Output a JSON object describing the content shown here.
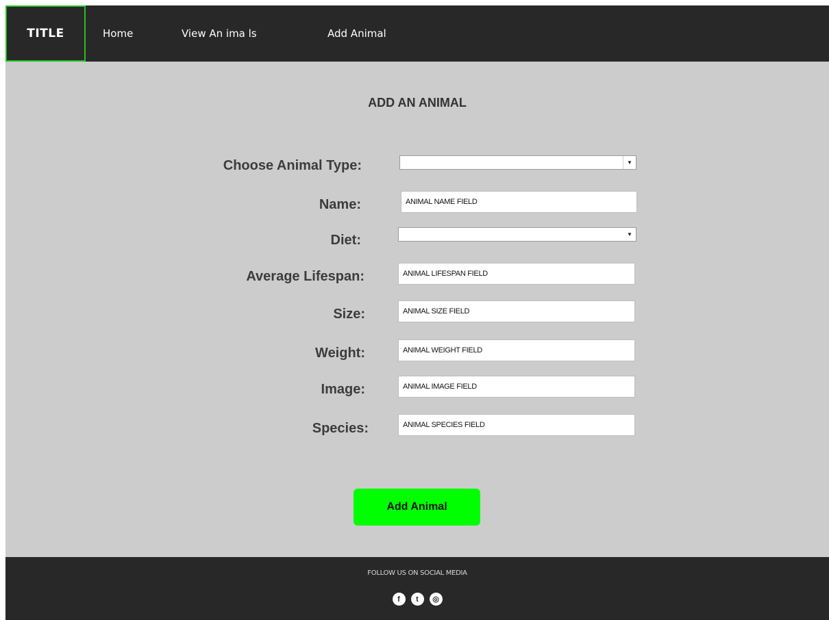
{
  "nav": {
    "brand": "TITLE",
    "links": [
      "Home",
      "View An ima ls",
      "Add Animal"
    ]
  },
  "main": {
    "title": "ADD AN ANIMAL",
    "fields": {
      "animal_type": {
        "label": "Choose Animal Type:",
        "value": ""
      },
      "name": {
        "label": "Name:",
        "value": "ANIMAL NAME FIELD"
      },
      "diet": {
        "label": "Diet:",
        "value": ""
      },
      "lifespan": {
        "label": "Average Lifespan:",
        "value": "ANIMAL LIFESPAN FIELD"
      },
      "size": {
        "label": "Size:",
        "value": "ANIMAL SIZE FIELD"
      },
      "weight": {
        "label": "Weight:",
        "value": "ANIMAL WEIGHT FIELD"
      },
      "image": {
        "label": "Image:",
        "value": "ANIMAL IMAGE FIELD"
      },
      "species": {
        "label": "Species:",
        "value": "ANIMAL SPECIES FIELD"
      }
    },
    "submit_label": "Add Animal"
  },
  "footer": {
    "follow_text": "FOLLOW US  ON SOCIAL MEDIA",
    "social_icons": [
      {
        "name": "facebook-icon",
        "glyph": "f"
      },
      {
        "name": "twitter-icon",
        "glyph": "t"
      },
      {
        "name": "dribbble-icon",
        "glyph": "◎"
      }
    ]
  },
  "colors": {
    "nav_bg": "#282828",
    "page_bg": "#cccccc",
    "brand_border": "#22c222",
    "submit_bg": "#00ff00"
  }
}
